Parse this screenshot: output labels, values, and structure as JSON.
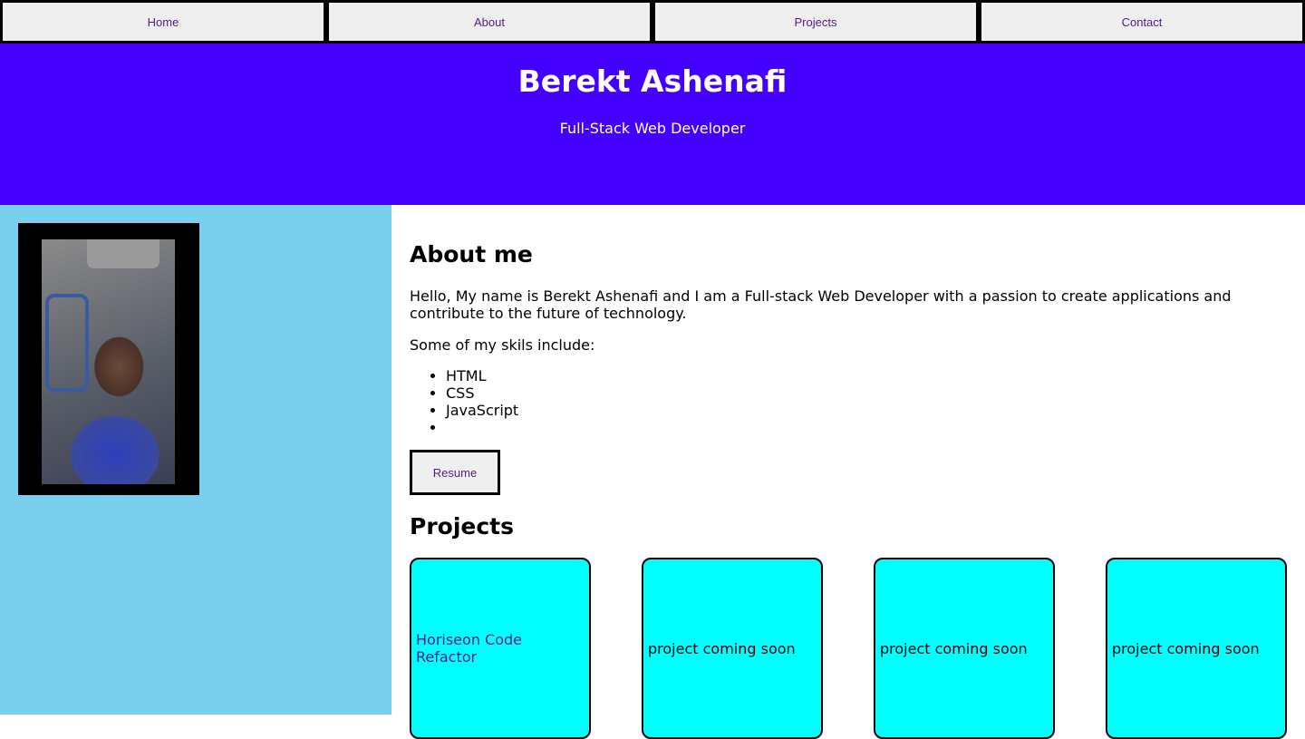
{
  "nav": {
    "items": [
      {
        "label": "Home"
      },
      {
        "label": "About"
      },
      {
        "label": "Projects"
      },
      {
        "label": "Contact"
      }
    ]
  },
  "header": {
    "title": "Berekt Ashenafi",
    "subtitle": "Full-Stack Web Developer"
  },
  "sidebar": {
    "photo_icon": "profile-photo"
  },
  "about": {
    "heading": "About me",
    "text": "Hello, My name is Berekt Ashenafi and I am a Full-stack Web Developer with a passion to create applications and contribute to the future of technology.",
    "skills_intro": "Some of my skils include:",
    "skills": [
      "HTML",
      "CSS",
      "JavaScript",
      ""
    ],
    "resume_label": "Resume"
  },
  "projects": {
    "heading": "Projects",
    "cards": [
      {
        "label": "Horiseon Code Refactor"
      },
      {
        "label": "project coming soon"
      },
      {
        "label": "project coming soon"
      },
      {
        "label": "project coming soon"
      }
    ]
  },
  "colors": {
    "header_bg": "#4400ff",
    "sidebar_bg": "#7acfee",
    "card_bg": "#00ffff",
    "link": "#551a8b"
  }
}
